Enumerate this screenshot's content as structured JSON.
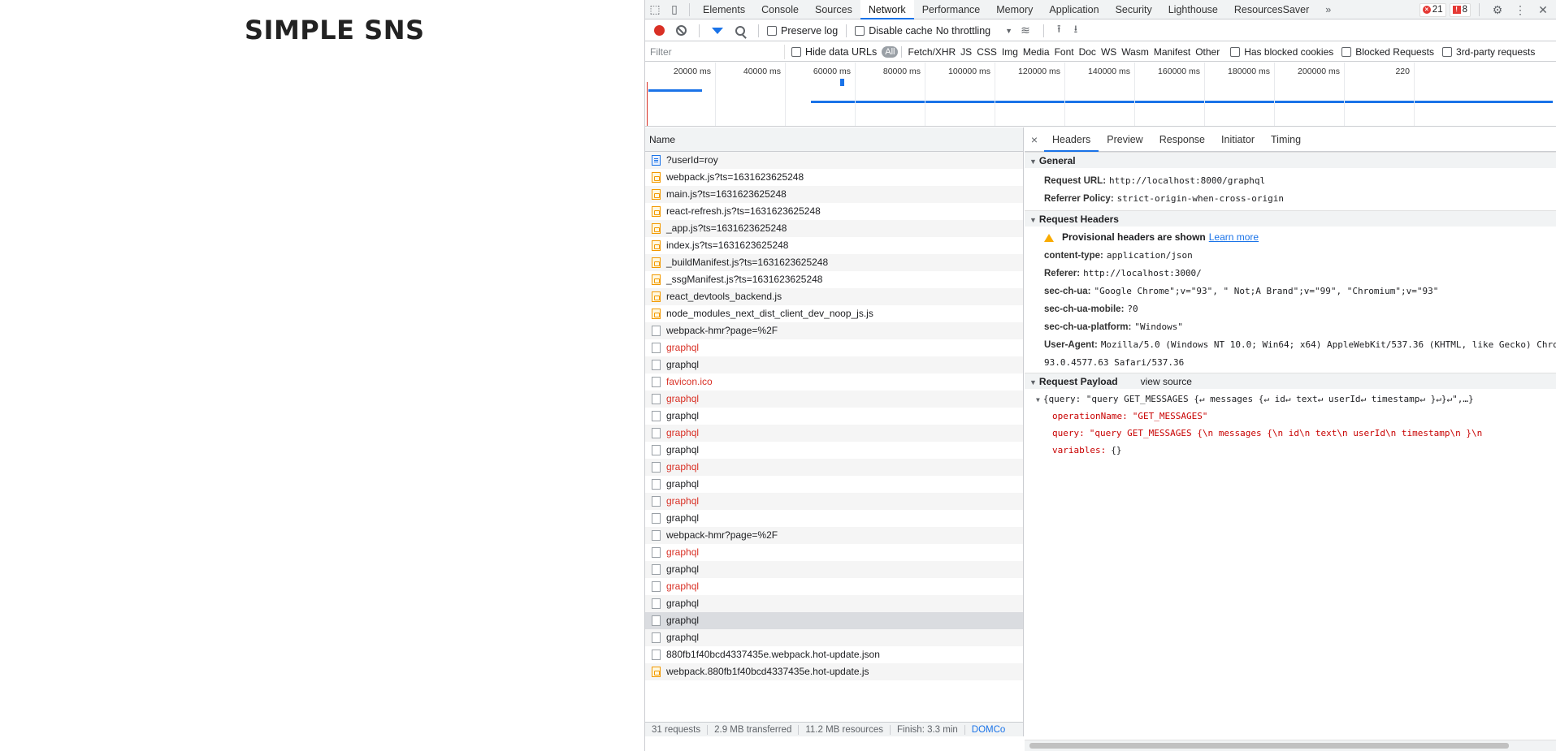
{
  "page": {
    "title": "SIMPLE SNS"
  },
  "devtools": {
    "tabs": [
      "Elements",
      "Console",
      "Sources",
      "Network",
      "Performance",
      "Memory",
      "Application",
      "Security",
      "Lighthouse",
      "ResourcesSaver"
    ],
    "active_tab": "Network",
    "more_tabs_icon": "»",
    "errors_count": "21",
    "issues_count": "8",
    "close_icon": "✕",
    "toolbar": {
      "preserve_log": "Preserve log",
      "disable_cache": "Disable cache",
      "throttling": "No throttling"
    },
    "filter": {
      "placeholder": "Filter",
      "hide_data_urls": "Hide data URLs",
      "types": [
        "All",
        "Fetch/XHR",
        "JS",
        "CSS",
        "Img",
        "Media",
        "Font",
        "Doc",
        "WS",
        "Wasm",
        "Manifest",
        "Other"
      ],
      "has_blocked_cookies": "Has blocked cookies",
      "blocked_requests": "Blocked Requests",
      "third_party": "3rd-party requests"
    },
    "overview_ticks": [
      "20000 ms",
      "40000 ms",
      "60000 ms",
      "80000 ms",
      "100000 ms",
      "120000 ms",
      "140000 ms",
      "160000 ms",
      "180000 ms",
      "200000 ms",
      "220"
    ],
    "list": {
      "header": "Name",
      "rows": [
        {
          "name": "?userId=roy",
          "icon": "doc",
          "red": false
        },
        {
          "name": "webpack.js?ts=1631623625248",
          "icon": "js",
          "red": false
        },
        {
          "name": "main.js?ts=1631623625248",
          "icon": "js",
          "red": false
        },
        {
          "name": "react-refresh.js?ts=1631623625248",
          "icon": "js",
          "red": false
        },
        {
          "name": "_app.js?ts=1631623625248",
          "icon": "js",
          "red": false
        },
        {
          "name": "index.js?ts=1631623625248",
          "icon": "js",
          "red": false
        },
        {
          "name": "_buildManifest.js?ts=1631623625248",
          "icon": "js",
          "red": false
        },
        {
          "name": "_ssgManifest.js?ts=1631623625248",
          "icon": "js",
          "red": false
        },
        {
          "name": "react_devtools_backend.js",
          "icon": "js",
          "red": false
        },
        {
          "name": "node_modules_next_dist_client_dev_noop_js.js",
          "icon": "js",
          "red": false
        },
        {
          "name": "webpack-hmr?page=%2F",
          "icon": "blank",
          "red": false
        },
        {
          "name": "graphql",
          "icon": "blank",
          "red": true
        },
        {
          "name": "graphql",
          "icon": "blank",
          "red": false
        },
        {
          "name": "favicon.ico",
          "icon": "blank",
          "red": true
        },
        {
          "name": "graphql",
          "icon": "blank",
          "red": true
        },
        {
          "name": "graphql",
          "icon": "blank",
          "red": false
        },
        {
          "name": "graphql",
          "icon": "blank",
          "red": true
        },
        {
          "name": "graphql",
          "icon": "blank",
          "red": false
        },
        {
          "name": "graphql",
          "icon": "blank",
          "red": true
        },
        {
          "name": "graphql",
          "icon": "blank",
          "red": false
        },
        {
          "name": "graphql",
          "icon": "blank",
          "red": true
        },
        {
          "name": "graphql",
          "icon": "blank",
          "red": false
        },
        {
          "name": "webpack-hmr?page=%2F",
          "icon": "blank",
          "red": false
        },
        {
          "name": "graphql",
          "icon": "blank",
          "red": true
        },
        {
          "name": "graphql",
          "icon": "blank",
          "red": false
        },
        {
          "name": "graphql",
          "icon": "blank",
          "red": true
        },
        {
          "name": "graphql",
          "icon": "blank",
          "red": false
        },
        {
          "name": "graphql",
          "icon": "blank",
          "red": false,
          "selected": true
        },
        {
          "name": "graphql",
          "icon": "blank",
          "red": false
        },
        {
          "name": "880fb1f40bcd4337435e.webpack.hot-update.json",
          "icon": "blank",
          "red": false
        },
        {
          "name": "webpack.880fb1f40bcd4337435e.hot-update.js",
          "icon": "js",
          "red": false
        }
      ]
    },
    "status": {
      "requests": "31 requests",
      "transferred": "2.9 MB transferred",
      "resources": "11.2 MB resources",
      "finish": "Finish: 3.3 min",
      "dom": "DOMCo"
    },
    "detail": {
      "close": "×",
      "tabs": [
        "Headers",
        "Preview",
        "Response",
        "Initiator",
        "Timing"
      ],
      "active_tab": "Headers",
      "general_title": "General",
      "general": [
        {
          "k": "Request URL:",
          "v": "http://localhost:8000/graphql"
        },
        {
          "k": "Referrer Policy:",
          "v": "strict-origin-when-cross-origin"
        }
      ],
      "req_headers_title": "Request Headers",
      "provisional": "Provisional headers are shown",
      "learn_more": "Learn more",
      "req_headers": [
        {
          "k": "content-type:",
          "v": "application/json"
        },
        {
          "k": "Referer:",
          "v": "http://localhost:3000/"
        },
        {
          "k": "sec-ch-ua:",
          "v": "\"Google Chrome\";v=\"93\", \" Not;A Brand\";v=\"99\", \"Chromium\";v=\"93\""
        },
        {
          "k": "sec-ch-ua-mobile:",
          "v": "?0"
        },
        {
          "k": "sec-ch-ua-platform:",
          "v": "\"Windows\""
        },
        {
          "k": "User-Agent:",
          "v": "Mozilla/5.0 (Windows NT 10.0; Win64; x64) AppleWebKit/537.36 (KHTML, like Gecko) Chro"
        }
      ],
      "ua_cont": "93.0.4577.63 Safari/537.36",
      "payload_title": "Request Payload",
      "view_source": "view source",
      "payload_summary": "{query: \"query GET_MESSAGES {↵ messages {↵ id↵ text↵ userId↵ timestamp↵ }↵}↵\",…}",
      "payload_items": [
        {
          "k": "operationName:",
          "v": "\"GET_MESSAGES\""
        },
        {
          "k": "query:",
          "v": "\"query GET_MESSAGES {\\n  messages {\\n    id\\n    text\\n    userId\\n    timestamp\\n  }\\n"
        },
        {
          "k": "variables:",
          "v": "{}"
        }
      ]
    }
  }
}
